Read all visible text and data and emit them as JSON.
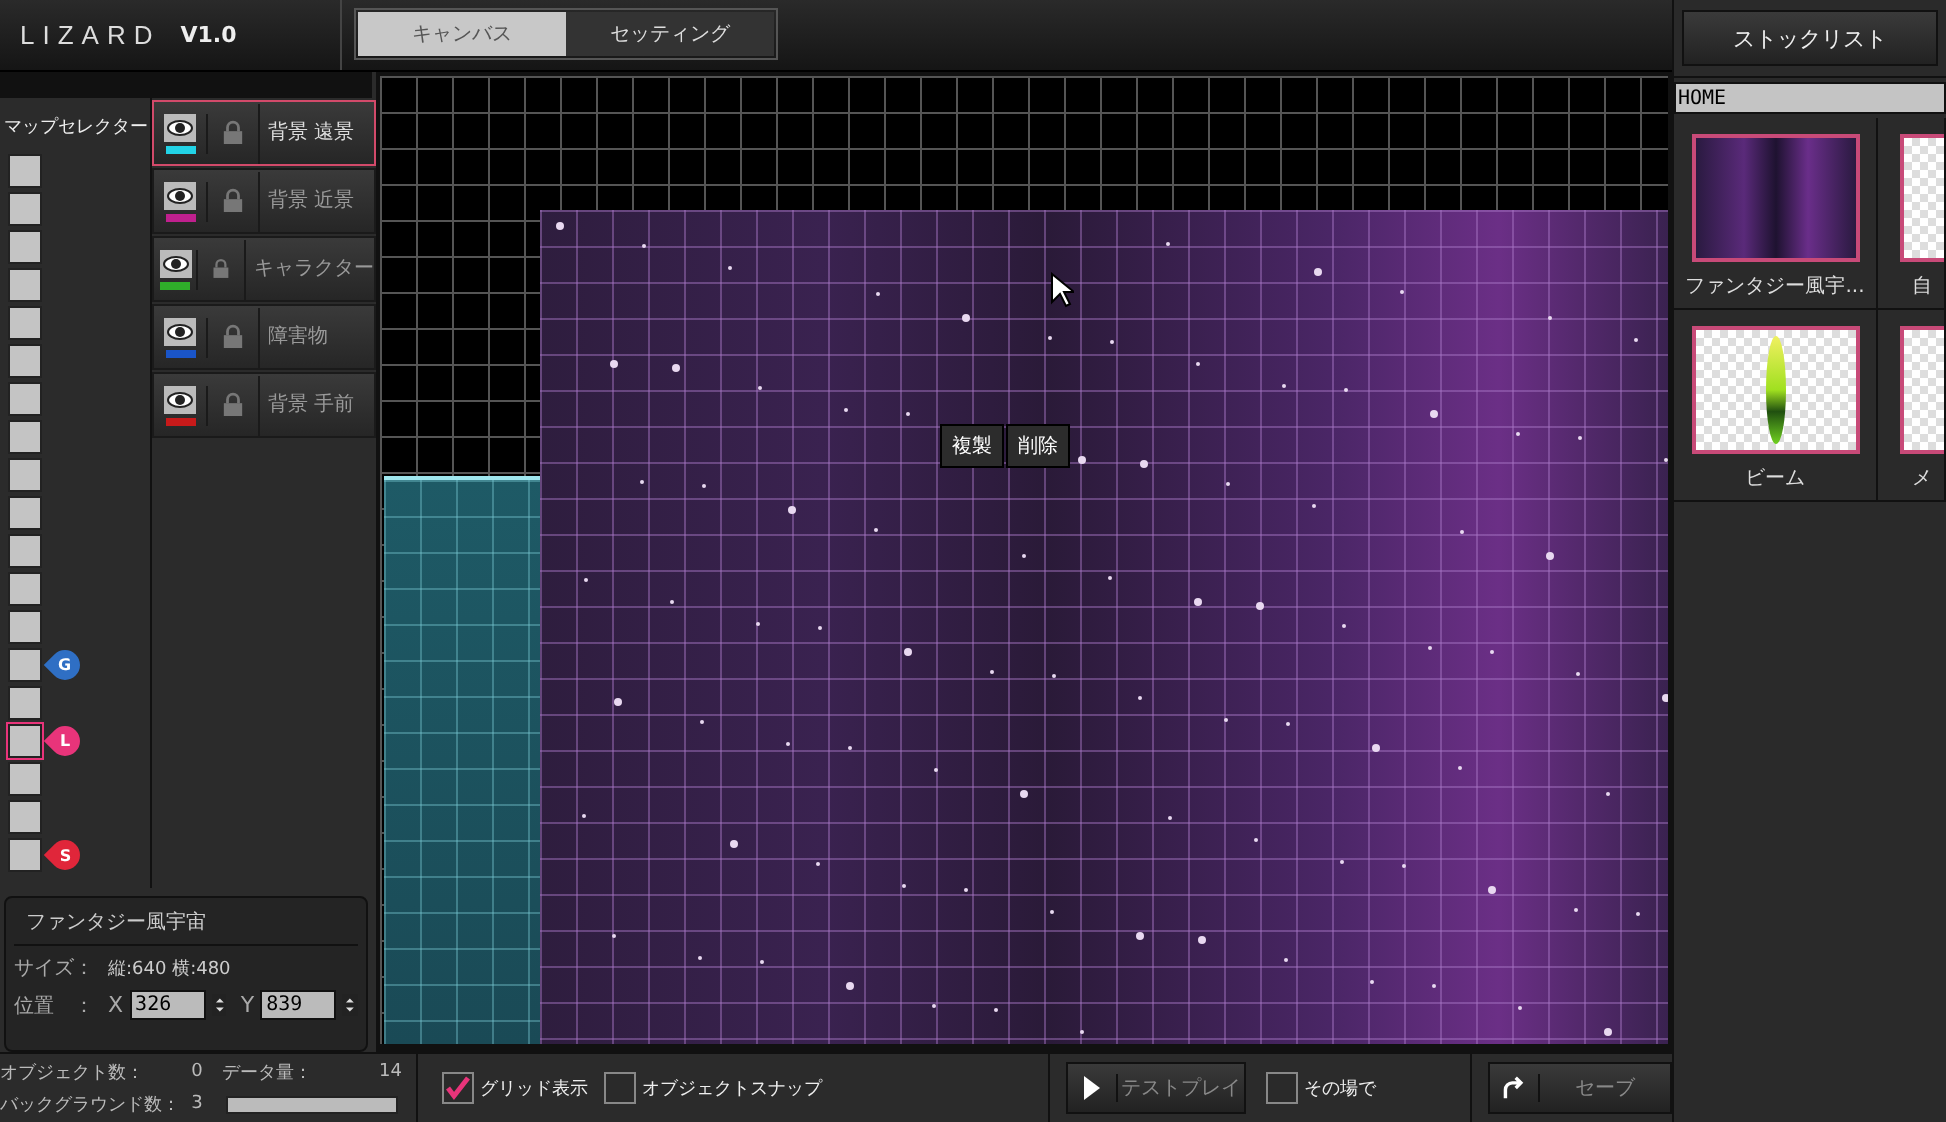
{
  "app": {
    "logo": "LIZARD",
    "version": "V1.0"
  },
  "tabs": [
    {
      "label": "キャンバス",
      "selected": true
    },
    {
      "label": "セッティング",
      "selected": false
    }
  ],
  "map_selector": {
    "title": "マップセレクター",
    "cells": [
      {
        "selected": false
      },
      {
        "selected": false
      },
      {
        "selected": false
      },
      {
        "selected": false
      },
      {
        "selected": false
      },
      {
        "selected": false
      },
      {
        "selected": false
      },
      {
        "selected": false
      },
      {
        "selected": false
      },
      {
        "selected": false
      },
      {
        "selected": false
      },
      {
        "selected": false
      },
      {
        "selected": false
      },
      {
        "selected": false,
        "marker": {
          "label": "G",
          "color": "#2f6fc4"
        }
      },
      {
        "selected": false
      },
      {
        "selected": true,
        "marker": {
          "label": "L",
          "color": "#e8347a"
        }
      },
      {
        "selected": false
      },
      {
        "selected": false
      },
      {
        "selected": false,
        "marker": {
          "label": "S",
          "color": "#e0263a"
        }
      }
    ]
  },
  "layers": [
    {
      "name": "背景 遠景",
      "color": "#22d3e6",
      "selected": true
    },
    {
      "name": "背景 近景",
      "color": "#c0208e",
      "selected": false
    },
    {
      "name": "キャラクター",
      "color": "#2fae2a",
      "selected": false
    },
    {
      "name": "障害物",
      "color": "#1a55c8",
      "selected": false
    },
    {
      "name": "背景 手前",
      "color": "#c81a1a",
      "selected": false
    }
  ],
  "canvas": {
    "context_menu": [
      "複製",
      "削除"
    ]
  },
  "info": {
    "title": "ファンタジー風宇宙",
    "size_label": "サイズ：",
    "size_value": "縦:640 横:480",
    "position_label": "位置　：",
    "x_label": "X",
    "x_value": "326",
    "y_label": "Y",
    "y_value": "839"
  },
  "stats": {
    "object_count_label": "オブジェクト数：",
    "object_count": "0",
    "data_label": "データ量：",
    "data_value": "14",
    "background_count_label": "バックグラウンド数：",
    "background_count": "3",
    "data_meter": {
      "level": 1
    }
  },
  "toolbar": {
    "options": [
      {
        "label": "グリッド表示",
        "checked": true
      },
      {
        "label": "オブジェクトスナップ",
        "checked": false
      }
    ],
    "test_play": "テストプレイ",
    "in_place": {
      "label": "その場で",
      "checked": false
    },
    "save": "セーブ"
  },
  "stock": {
    "button": "ストックリスト",
    "path": "HOME",
    "items": [
      {
        "label": "ファンタジー風宇...",
        "kind": "space"
      },
      {
        "label": "自",
        "kind": "blank"
      },
      {
        "label": "ビーム",
        "kind": "beam"
      },
      {
        "label": "メ",
        "kind": "creature"
      }
    ]
  }
}
